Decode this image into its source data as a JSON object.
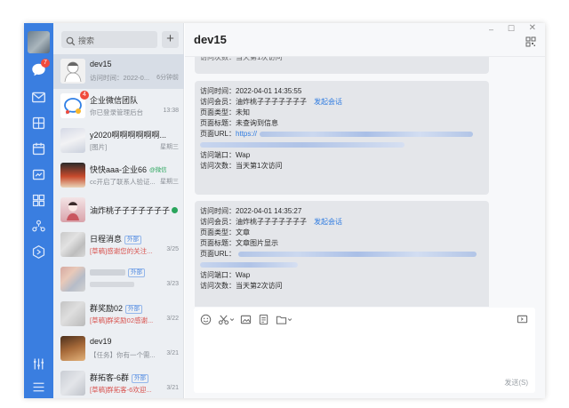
{
  "window": {
    "min": "–",
    "max": "☐",
    "close": "✕"
  },
  "sidebar": {
    "icons": [
      "chat-icon",
      "mail-icon",
      "docs-icon",
      "calendar-icon",
      "workbench-icon",
      "apps-icon",
      "contacts-icon",
      "hexagon-icon",
      "settings-icon",
      "menu-icon"
    ],
    "badge": "7"
  },
  "search": {
    "placeholder": "搜索",
    "add": "+"
  },
  "conversations": [
    {
      "name": "dev15",
      "preview": "访问时间：2022-0...",
      "time": "6分钟前",
      "active": true
    },
    {
      "name": "企业微信团队",
      "preview": "你已登录管理后台",
      "time": "13:38",
      "badge": "4"
    },
    {
      "name": "y2020啊啊啊啊啊啊...",
      "preview": "[图片]",
      "time": "星期三"
    },
    {
      "name": "快快aaa-企业66",
      "tag": "@微信",
      "preview": "cc开启了联系人验证...",
      "time": "星期三"
    },
    {
      "name": "油炸桃子子子子子子子",
      "preview": "",
      "time": ""
    },
    {
      "name": "日程消息",
      "tag": "外部",
      "preview": "[草稿]感谢您的关注...",
      "time": "3/25"
    },
    {
      "name": "",
      "tag": "外部",
      "preview": "",
      "time": "3/23"
    },
    {
      "name": "群奖励02",
      "tag": "外部",
      "preview": "[草稿]群奖励02感谢...",
      "time": "3/22"
    },
    {
      "name": "dev19",
      "preview": "【任务】你有一个需...",
      "time": "3/21"
    },
    {
      "name": "群拓客-6群",
      "tag": "外部",
      "preview": "[草稿]群拓客-6欢迎...",
      "time": "3/21"
    }
  ],
  "chat": {
    "title": "dev15",
    "top_partial": "访问次数：当天第1次访问",
    "cards": [
      {
        "time_label": "访问时间：",
        "time": "2022-04-01 14:35:55",
        "member_label": "访问会员：",
        "member": "油炸桃子子子子子子子",
        "action": "发起会话",
        "type_label": "页面类型：",
        "type": "未知",
        "title_label": "页面标题：",
        "title": "未查询到信息",
        "url_label": "页面URL：",
        "url": "https://",
        "port_label": "访问端口：",
        "port": "Wap",
        "count_label": "访问次数：",
        "count": "当天第1次访问"
      },
      {
        "time_label": "访问时间：",
        "time": "2022-04-01 14:35:27",
        "member_label": "访问会员：",
        "member": "油炸桃子子子子子子子",
        "action": "发起会话",
        "type_label": "页面类型：",
        "type": "文章",
        "title_label": "页面标题：",
        "title": "文章图片显示",
        "url_label": "页面URL：",
        "url": "",
        "port_label": "访问端口：",
        "port": "Wap",
        "count_label": "访问次数：",
        "count": "当天第2次访问"
      }
    ]
  },
  "composer": {
    "send": "发送(S)",
    "tools": [
      "emoji-icon",
      "scissors-icon",
      "image-icon",
      "file-icon",
      "folder-icon",
      "feedback-icon"
    ]
  },
  "colors": {
    "rail": "#3a7ee0",
    "link": "#2e7be0",
    "badge": "#f04b3c"
  }
}
